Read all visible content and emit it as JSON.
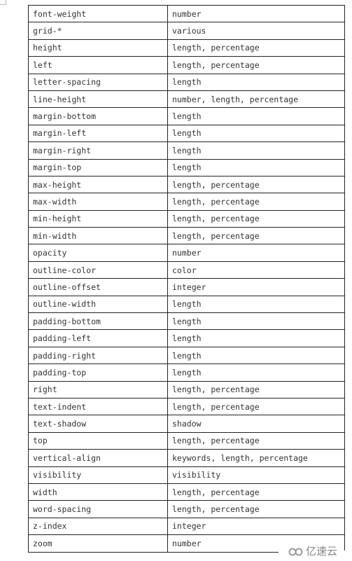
{
  "table": {
    "rows": [
      [
        "font-weight",
        "number"
      ],
      [
        "grid-*",
        "various"
      ],
      [
        "height",
        "length, percentage"
      ],
      [
        "left",
        "length, percentage"
      ],
      [
        "letter-spacing",
        "length"
      ],
      [
        "line-height",
        "number, length, percentage"
      ],
      [
        "margin-bottom",
        "length"
      ],
      [
        "margin-left",
        "length"
      ],
      [
        "margin-right",
        "length"
      ],
      [
        "margin-top",
        "length"
      ],
      [
        "max-height",
        "length, percentage"
      ],
      [
        "max-width",
        "length, percentage"
      ],
      [
        "min-height",
        "length, percentage"
      ],
      [
        "min-width",
        "length, percentage"
      ],
      [
        "opacity",
        "number"
      ],
      [
        "outline-color",
        "color"
      ],
      [
        "outline-offset",
        "integer"
      ],
      [
        "outline-width",
        "length"
      ],
      [
        "padding-bottom",
        "length"
      ],
      [
        "padding-left",
        "length"
      ],
      [
        "padding-right",
        "length"
      ],
      [
        "padding-top",
        "length"
      ],
      [
        "right",
        "length, percentage"
      ],
      [
        "text-indent",
        "length, percentage"
      ],
      [
        "text-shadow",
        "shadow"
      ],
      [
        "top",
        "length, percentage"
      ],
      [
        "vertical-align",
        "keywords, length, percentage"
      ],
      [
        "visibility",
        "visibility"
      ],
      [
        "width",
        "length, percentage"
      ],
      [
        "word-spacing",
        "length, percentage"
      ],
      [
        "z-index",
        "integer"
      ],
      [
        "zoom",
        "number"
      ]
    ]
  },
  "watermark": {
    "text": "亿速云",
    "icon": "cloud-logo-icon"
  }
}
